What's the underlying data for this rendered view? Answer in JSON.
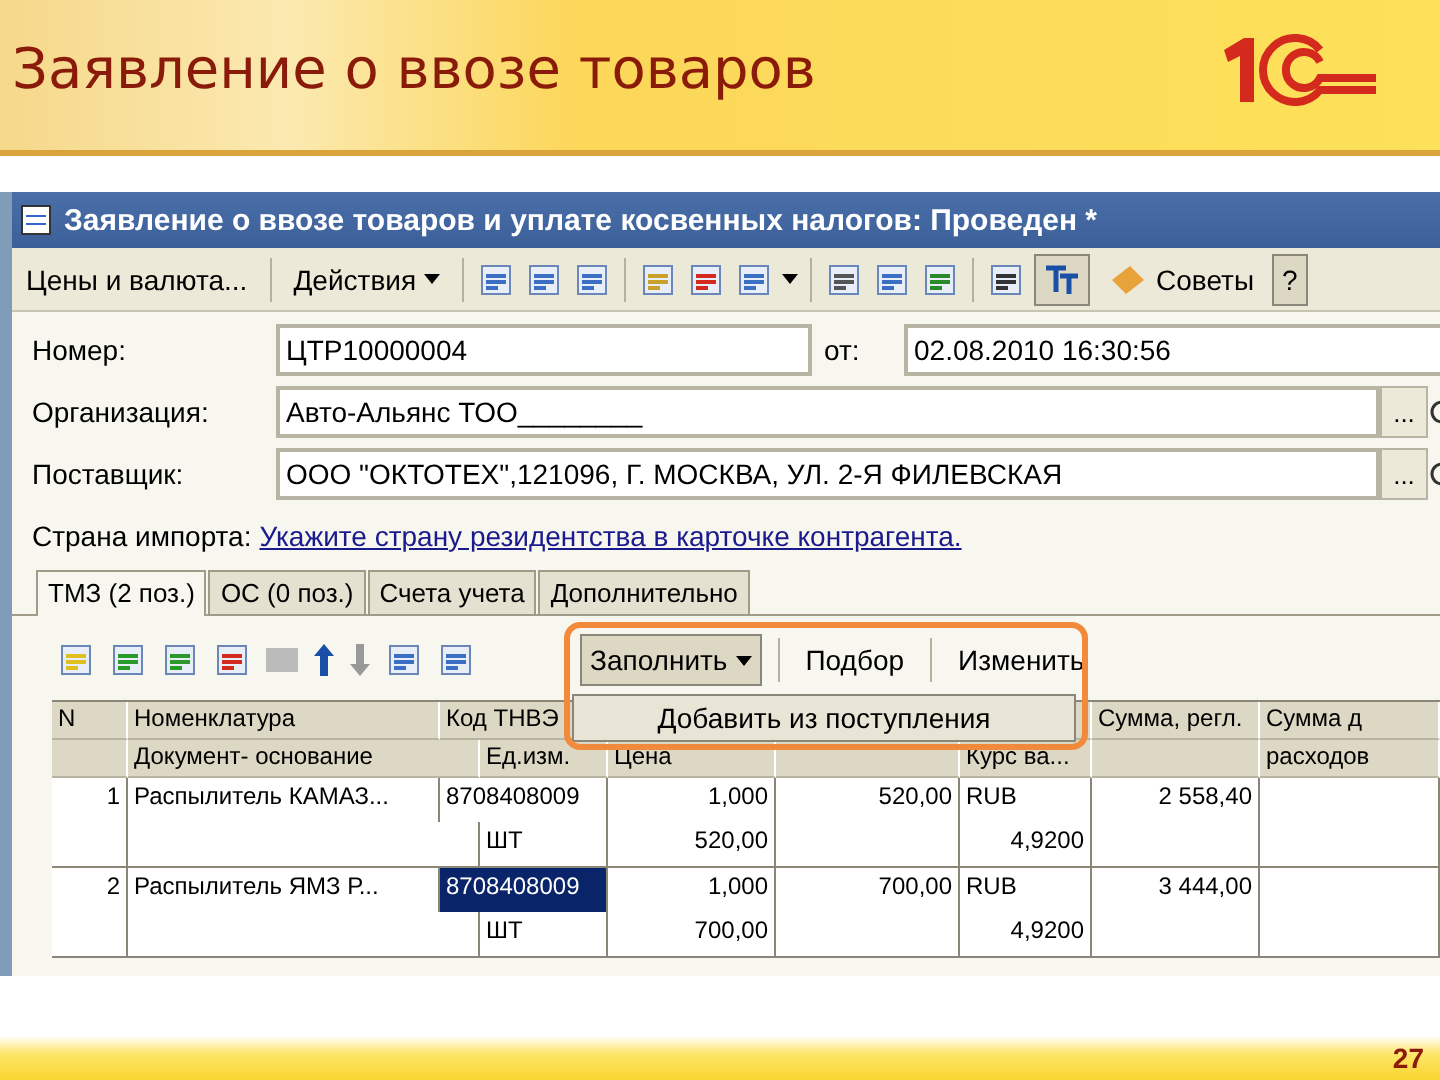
{
  "slide": {
    "title": "Заявление о ввозе товаров",
    "page_number": "27"
  },
  "window": {
    "title": "Заявление о ввозе товаров и уплате косвенных налогов: Проведен *"
  },
  "toolbar": {
    "prices_button": "Цены и валюта...",
    "actions_button": "Действия",
    "tips_button": "Советы",
    "help_button": "?"
  },
  "form": {
    "number_label": "Номер:",
    "number_value": "ЦТР10000004",
    "date_label": "от:",
    "date_value": "02.08.2010 16:30:56",
    "fields": [
      {
        "label": "Организация:",
        "value": "Авто-Альянс ТОО________",
        "button": "..."
      },
      {
        "label": "Поставщик:",
        "value": "ООО \"ОКТОТЕХ\",121096, Г. МОСКВА, УЛ. 2-Я ФИЛЕВСКАЯ",
        "button": "..."
      }
    ],
    "country_label": "Страна импорта:",
    "country_link": "Укажите страну резидентства в карточке контрагента."
  },
  "tabs": [
    {
      "label": "ТМЗ (2 поз.)",
      "selected": true
    },
    {
      "label": "ОС (0 поз.)",
      "selected": false
    },
    {
      "label": "Счета учета",
      "selected": false
    },
    {
      "label": "Дополнительно",
      "selected": false
    }
  ],
  "table_toolbar": {
    "fill_button": {
      "label": "Заполнить",
      "expanded": true,
      "items": [
        "Добавить из поступления"
      ]
    },
    "buttons": [
      "Подбор",
      "Изменить"
    ]
  },
  "table": {
    "header": {
      "n": "N",
      "nomenclature": "Номенклатура",
      "code": "Код ТНВЭ",
      "document": "Документ- основание",
      "unit": "Ед.изм.",
      "price": "Цена",
      "rate": "Курс ва...",
      "sum": "Сумма, регл.",
      "column_8_top": "Сумма д",
      "column_8_bottom": "расходов"
    },
    "rows": [
      {
        "n": "1",
        "nomenclature": "Распылитель КАМАЗ...",
        "code": "8708408009",
        "code_selected": false,
        "unit": "ШТ",
        "quantity": "1,000",
        "price_line": "520,00",
        "amount": "520,00",
        "currency": "RUB",
        "rate": "4,9200",
        "sum": "2 558,40"
      },
      {
        "n": "2",
        "nomenclature": "Распылитель ЯМЗ Р...",
        "code": "8708408009",
        "code_selected": true,
        "unit": "ШТ",
        "quantity": "1,000",
        "price_line": "700,00",
        "amount": "700,00",
        "currency": "RUB",
        "rate": "4,9200",
        "sum": "3 444,00"
      }
    ]
  }
}
